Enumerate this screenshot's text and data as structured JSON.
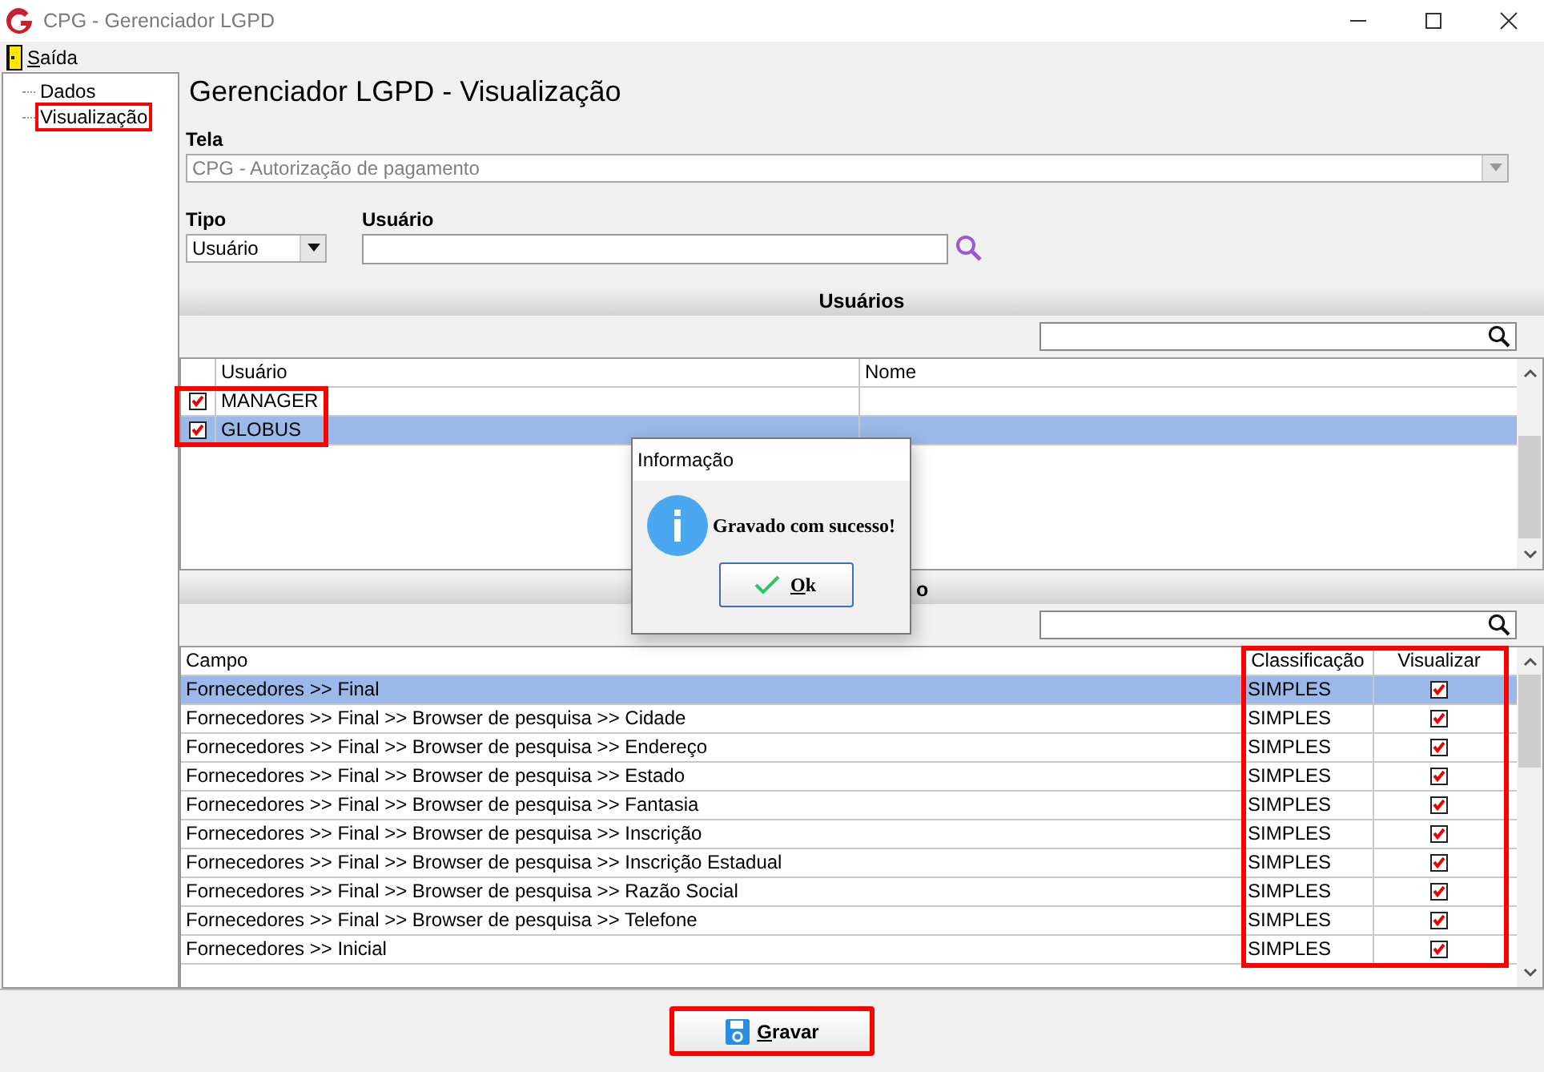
{
  "window": {
    "title": "CPG - Gerenciador LGPD"
  },
  "menu": [
    {
      "label": "Saída"
    }
  ],
  "tree": [
    {
      "label": "Dados",
      "highlighted": false
    },
    {
      "label": "Visualização",
      "highlighted": true
    }
  ],
  "heading": "Gerenciador LGPD - Visualização",
  "tela": {
    "label": "Tela",
    "value": "CPG - Autorização de pagamento",
    "disabled": true
  },
  "tipo": {
    "label": "Tipo",
    "value": "Usuário"
  },
  "usuario": {
    "label": "Usuário"
  },
  "usuarios": {
    "title": "Usuários",
    "highlighted": true,
    "columns": [
      "Usuário",
      "Nome"
    ],
    "rows": [
      {
        "checked": true,
        "usuario": "MANAGER",
        "selected": false
      },
      {
        "checked": true,
        "usuario": "GLOBUS",
        "selected": true
      }
    ]
  },
  "campos": {
    "title": "o",
    "highlighted": true,
    "columns": [
      "Campo",
      "Classificação",
      "Visualizar"
    ],
    "rows": [
      {
        "campo": "Fornecedores >> Final",
        "classificacao": "SIMPLES",
        "visualizar": true,
        "selected": true
      },
      {
        "campo": "Fornecedores >> Final >> Browser de pesquisa >> Cidade",
        "classificacao": "SIMPLES",
        "visualizar": true,
        "selected": false
      },
      {
        "campo": "Fornecedores >> Final >> Browser de pesquisa >> Endereço",
        "classificacao": "SIMPLES",
        "visualizar": true,
        "selected": false
      },
      {
        "campo": "Fornecedores >> Final >> Browser de pesquisa >> Estado",
        "classificacao": "SIMPLES",
        "visualizar": true,
        "selected": false
      },
      {
        "campo": "Fornecedores >> Final >> Browser de pesquisa >> Fantasia",
        "classificacao": "SIMPLES",
        "visualizar": true,
        "selected": false
      },
      {
        "campo": "Fornecedores >> Final >> Browser de pesquisa >> Inscrição",
        "classificacao": "SIMPLES",
        "visualizar": true,
        "selected": false
      },
      {
        "campo": "Fornecedores >> Final >> Browser de pesquisa >> Inscrição Estadual",
        "classificacao": "SIMPLES",
        "visualizar": true,
        "selected": false
      },
      {
        "campo": "Fornecedores >> Final >> Browser de pesquisa >> Razão Social",
        "classificacao": "SIMPLES",
        "visualizar": true,
        "selected": false
      },
      {
        "campo": "Fornecedores >> Final >> Browser de pesquisa >> Telefone",
        "classificacao": "SIMPLES",
        "visualizar": true,
        "selected": false
      },
      {
        "campo": "Fornecedores >> Inicial",
        "classificacao": "SIMPLES",
        "visualizar": true,
        "selected": false
      }
    ]
  },
  "dialog": {
    "title": "Informação",
    "message": "Gravado com sucesso!",
    "button": "Ok"
  },
  "save_button": {
    "label": "Gravar",
    "highlighted": true
  }
}
